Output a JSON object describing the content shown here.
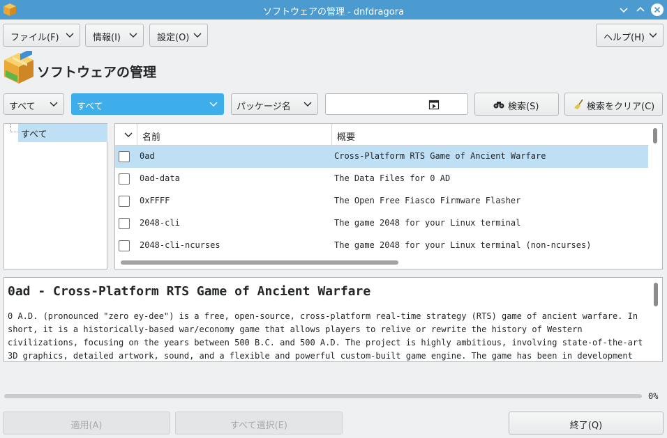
{
  "window": {
    "title": "ソフトウェアの管理 - dnfdragora",
    "controls": [
      "chevron-down-icon",
      "chevron-up-icon",
      "close-icon"
    ]
  },
  "menus": {
    "file": "ファイル(F)",
    "info": "情報(I)",
    "settings": "設定(O)",
    "help": "ヘルプ(H)"
  },
  "header": {
    "title": "ソフトウェアの管理",
    "icon": "package-box-icon"
  },
  "filters": {
    "view": "すべて",
    "status": "すべて",
    "search_field": "パッケージ名",
    "search_value": "",
    "search_button": "検索(S)",
    "clear_button": "検索をクリア(C)"
  },
  "groups": [
    {
      "label": "すべて",
      "selected": true
    }
  ],
  "table": {
    "columns": [
      "名前",
      "概要"
    ],
    "rows": [
      {
        "name": "0ad",
        "summary": "Cross-Platform RTS Game of Ancient Warfare",
        "checked": false,
        "selected": true
      },
      {
        "name": "0ad-data",
        "summary": "The Data Files for 0 AD",
        "checked": false,
        "selected": false
      },
      {
        "name": "0xFFFF",
        "summary": "The Open Free Fiasco Firmware Flasher",
        "checked": false,
        "selected": false
      },
      {
        "name": "2048-cli",
        "summary": "The game 2048 for your Linux terminal",
        "checked": false,
        "selected": false
      },
      {
        "name": "2048-cli-ncurses",
        "summary": "The game 2048 for your Linux terminal (non-ncurses)",
        "checked": false,
        "selected": false
      }
    ]
  },
  "info": {
    "title": "0ad - Cross-Platform RTS Game of Ancient Warfare",
    "description": "0 A.D. (pronounced \"zero ey-dee\") is a free, open-source, cross-platform real-time strategy (RTS) game of ancient warfare. In short, it is a historically-based war/economy game that allows players to relive or rewrite the history of Western civilizations, focusing on the years between 500 B.C. and 500 A.D. The project is highly ambitious, involving state-of-the-art 3D graphics, detailed artwork, sound, and a flexible and powerful custom-built game engine. The game has been in development by Wildfire Games (WFG), a group of volunteer, hobbyist"
  },
  "progress": {
    "value": 0,
    "label": "0%"
  },
  "buttons": {
    "apply": "適用(A)",
    "select_all": "すべて選択(E)",
    "quit": "終了(Q)"
  },
  "colors": {
    "titlebar": "#4b9bd1",
    "accent": "#3daee9",
    "selection": "#bfdff4"
  }
}
